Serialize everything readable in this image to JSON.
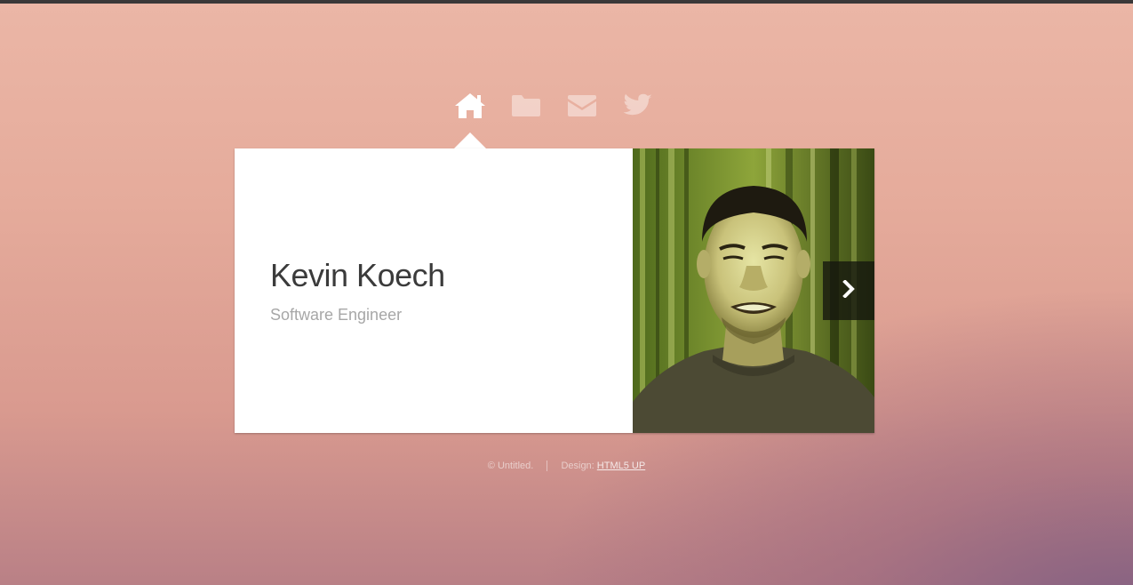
{
  "nav": {
    "items": [
      {
        "icon": "home-icon",
        "active": true
      },
      {
        "icon": "folder-icon",
        "active": false
      },
      {
        "icon": "envelope-icon",
        "active": false
      },
      {
        "icon": "twitter-icon",
        "active": false
      }
    ]
  },
  "profile": {
    "name": "Kevin Koech",
    "title": "Software Engineer"
  },
  "footer": {
    "copyright": "© Untitled.",
    "design_label": "Design:",
    "design_link": "HTML5 UP"
  },
  "colors": {
    "background_top": "#ebb6a6",
    "background_bottom": "#b98086",
    "card": "#ffffff",
    "name_text": "#3b3b3b",
    "role_text": "#a7a7a7"
  }
}
